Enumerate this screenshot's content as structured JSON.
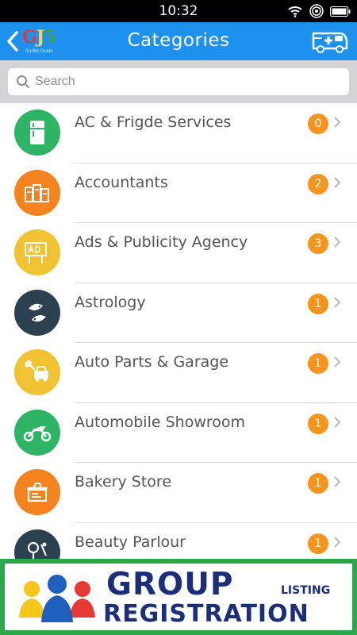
{
  "status_bar": {
    "time": "10:32"
  },
  "header": {
    "title": "Categories",
    "logo_text": "GJ5",
    "logo_tagline": "Surfile Guide"
  },
  "search": {
    "placeholder": "Search"
  },
  "categories": [
    {
      "name": "AC & Frigde Services",
      "count": "0",
      "color": "#2db565",
      "icon": "fridge-icon"
    },
    {
      "name": "Accountants",
      "count": "2",
      "color": "#f4831f",
      "icon": "accounts-books-icon"
    },
    {
      "name": "Ads & Publicity Agency",
      "count": "3",
      "color": "#f1c232",
      "icon": "ad-board-icon"
    },
    {
      "name": "Astrology",
      "count": "1",
      "color": "#2b4150",
      "icon": "pisces-icon"
    },
    {
      "name": "Auto Parts & Garage",
      "count": "1",
      "color": "#f1c232",
      "icon": "wrench-car-icon"
    },
    {
      "name": "Automobile Showroom",
      "count": "1",
      "color": "#2db565",
      "icon": "motorbike-icon"
    },
    {
      "name": "Bakery Store",
      "count": "1",
      "color": "#f4831f",
      "icon": "bakery-oven-icon"
    },
    {
      "name": "Beauty Parlour",
      "count": "1",
      "color": "#2b4150",
      "icon": "beauty-mirror-icon"
    }
  ],
  "banner": {
    "line1": "GROUP",
    "line1_suffix": "LISTING",
    "line2": "REGISTRATION"
  },
  "colors": {
    "header": "#1e90ee",
    "badge": "#f7941d",
    "banner_bg": "#2aa84a",
    "banner_text": "#1b2e7a"
  }
}
